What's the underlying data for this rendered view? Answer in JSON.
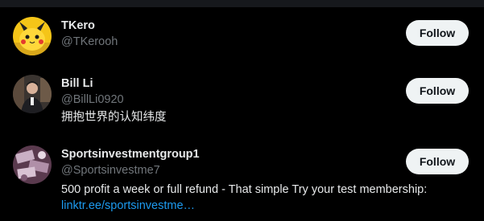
{
  "colors": {
    "background": "#000000",
    "text_primary": "#e7e9ea",
    "text_secondary": "#71767b",
    "link": "#1d9bf0",
    "button_bg": "#eff3f4",
    "button_text": "#0f1419"
  },
  "users": [
    {
      "name": "TKero",
      "handle": "@TKerooh",
      "bio": "",
      "follow_label": "Follow",
      "avatar_icon": "pikachu-avatar"
    },
    {
      "name": "Bill Li",
      "handle": "@BillLi0920",
      "bio": "拥抱世界的认知纬度",
      "follow_label": "Follow",
      "avatar_icon": "person-photo-avatar"
    },
    {
      "name": "Sportsinvestmentgroup1",
      "handle": "@Sportsinvestme7",
      "bio": "500 profit a week or full refund - That simple Try your test membership:",
      "bio_link": "linktr.ee/sportsinvestme…",
      "follow_label": "Follow",
      "avatar_icon": "money-photo-avatar"
    }
  ]
}
